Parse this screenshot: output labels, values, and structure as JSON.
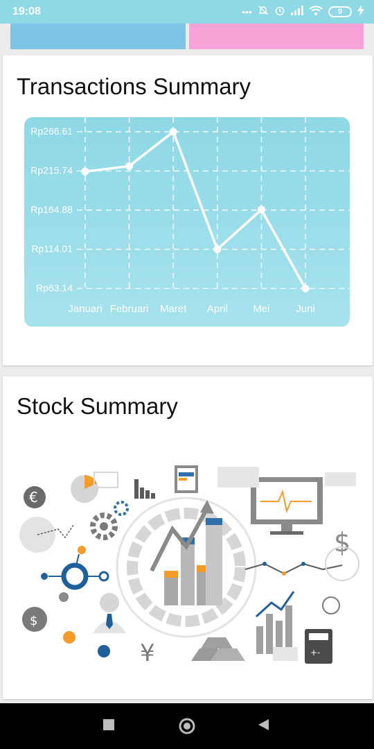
{
  "status_bar": {
    "time": "19:08",
    "icons": [
      "more-dots-icon",
      "mute-bell-icon",
      "alarm-icon",
      "signal-icon",
      "wifi-icon",
      "battery-icon",
      "charging-icon"
    ],
    "battery_level": "9"
  },
  "tiles": [
    {
      "name": "blue",
      "color": "#7ec4e7"
    },
    {
      "name": "pink",
      "color": "#f7a3d8"
    }
  ],
  "transactions": {
    "title": "Transactions Summary"
  },
  "chart_data": {
    "type": "line",
    "categories": [
      "Januari",
      "Februari",
      "Maret",
      "April",
      "Mei",
      "Juni"
    ],
    "values": [
      215.0,
      222.0,
      266.61,
      114.01,
      165.5,
      63.14
    ],
    "ytick_labels": [
      "Rp63.14",
      "Rp114.01",
      "Rp164.88",
      "Rp215.74",
      "Rp266.61"
    ],
    "ylim": [
      63.14,
      266.61
    ],
    "title": "",
    "xlabel": "",
    "ylabel": "",
    "grid": true,
    "line_color": "#ffffff",
    "background": "#8fd8e6"
  },
  "stock": {
    "title": "Stock Summary",
    "illustration": "finance-infographic-illustration"
  },
  "nav": {
    "icons": [
      "recent-apps-icon",
      "home-icon",
      "back-icon"
    ]
  }
}
